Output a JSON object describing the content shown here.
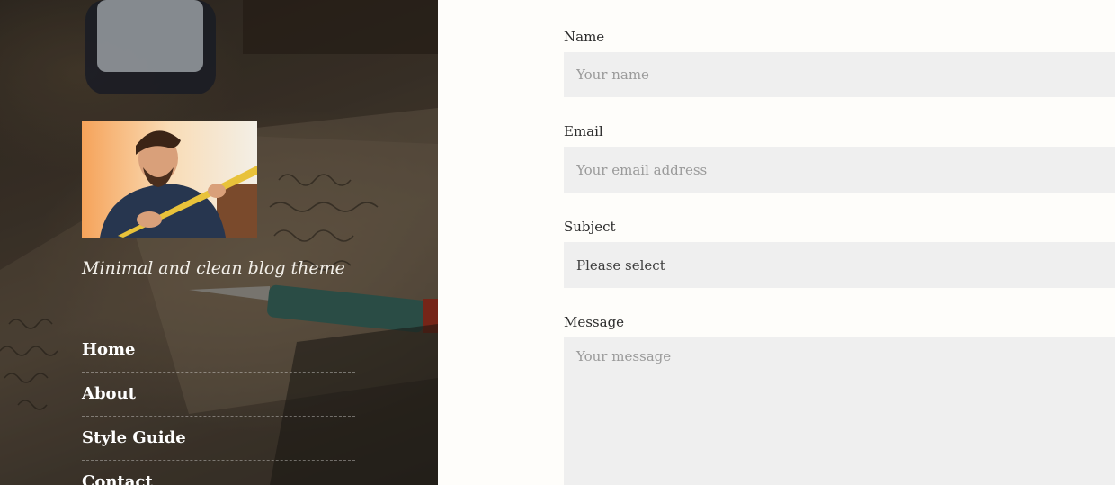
{
  "sidebar": {
    "tagline": "Minimal and clean blog theme",
    "nav": [
      {
        "label": "Home"
      },
      {
        "label": "About"
      },
      {
        "label": "Style Guide"
      },
      {
        "label": "Contact"
      }
    ]
  },
  "form": {
    "name": {
      "label": "Name",
      "placeholder": "Your name"
    },
    "email": {
      "label": "Email",
      "placeholder": "Your email address"
    },
    "subject": {
      "label": "Subject",
      "value": "Please select"
    },
    "message": {
      "label": "Message",
      "placeholder": "Your message"
    }
  },
  "colors": {
    "field_background": "#efefef",
    "page_background": "#fefdfa",
    "sidebar_text": "#ffffff"
  }
}
